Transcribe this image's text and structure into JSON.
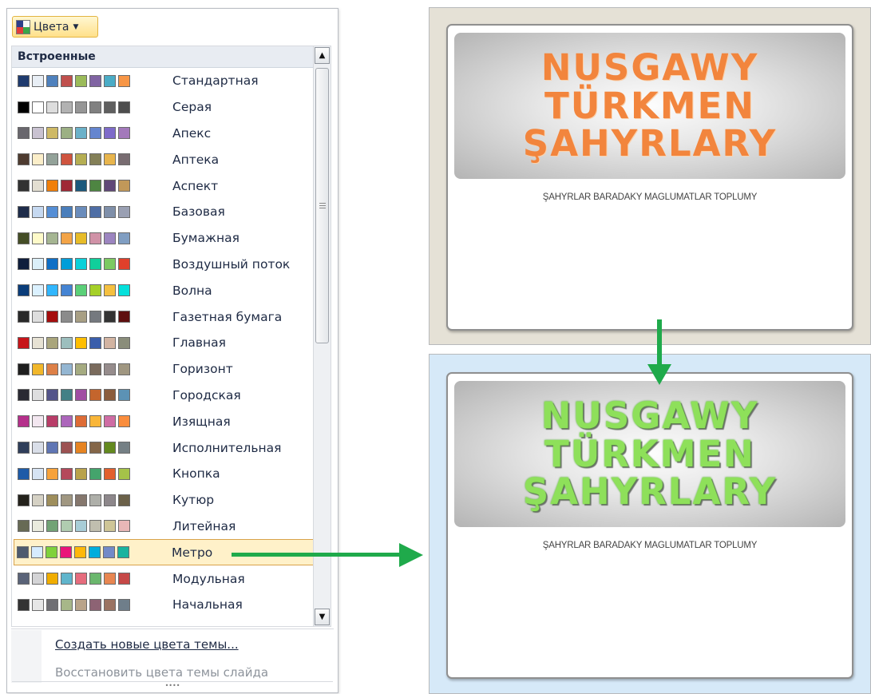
{
  "colors_button": {
    "label": "Цвета",
    "icon": "color-scheme-icon",
    "icon_colors": [
      "#2c3e8a",
      "#f7f7f7",
      "#e23b3b",
      "#3aa64a"
    ]
  },
  "panel": {
    "section_title": "Встроенные",
    "scroll_position": 0.0,
    "schemes": [
      {
        "name": "Стандартная",
        "selected": false,
        "colors": [
          "#1f3b6e",
          "#e8eef5",
          "#4f81bd",
          "#c0504d",
          "#9bbb59",
          "#8064a2",
          "#4bacc6",
          "#f79646"
        ]
      },
      {
        "name": "Серая",
        "selected": false,
        "colors": [
          "#000000",
          "#ffffff",
          "#dddddd",
          "#b2b2b2",
          "#969696",
          "#808080",
          "#5f5f5f",
          "#4d4d4d"
        ]
      },
      {
        "name": "Апекс",
        "selected": false,
        "colors": [
          "#69676d",
          "#c9c2d1",
          "#ceb966",
          "#9cb084",
          "#6bb1c9",
          "#6585cf",
          "#7e6bc9",
          "#a379bb"
        ]
      },
      {
        "name": "Аптека",
        "selected": false,
        "colors": [
          "#4e3b30",
          "#fbeec9",
          "#93a299",
          "#cf543f",
          "#b5ae53",
          "#848058",
          "#e8b54d",
          "#786c71"
        ]
      },
      {
        "name": "Аспект",
        "selected": false,
        "colors": [
          "#323232",
          "#e3ded1",
          "#f07f09",
          "#9f2936",
          "#1b587c",
          "#4e8542",
          "#604878",
          "#c19859"
        ]
      },
      {
        "name": "Базовая",
        "selected": false,
        "colors": [
          "#1e2c4a",
          "#c6d9f1",
          "#558ed5",
          "#4a7ebb",
          "#6a8cbb",
          "#4f6ea5",
          "#7f8fa9",
          "#9aa0b3"
        ]
      },
      {
        "name": "Бумажная",
        "selected": false,
        "colors": [
          "#444d26",
          "#fefac9",
          "#a5b592",
          "#f3a447",
          "#e7bc29",
          "#d092a7",
          "#9c85c0",
          "#809ec2"
        ]
      },
      {
        "name": "Воздушный поток",
        "selected": false,
        "colors": [
          "#0f1e3c",
          "#dbeff9",
          "#0f6fc6",
          "#009dd9",
          "#0bd0d9",
          "#10cf9b",
          "#7cca62",
          "#e0402b"
        ]
      },
      {
        "name": "Волна",
        "selected": false,
        "colors": [
          "#0a3d7a",
          "#dbf1ff",
          "#31b6fd",
          "#4584d3",
          "#5bd078",
          "#a5d028",
          "#f5c040",
          "#05e0db"
        ]
      },
      {
        "name": "Газетная бумага",
        "selected": false,
        "colors": [
          "#292929",
          "#dedede",
          "#a50e0e",
          "#8b8b8b",
          "#a89f84",
          "#75797f",
          "#333333",
          "#5e0f0f"
        ]
      },
      {
        "name": "Главная",
        "selected": false,
        "colors": [
          "#c7151a",
          "#e7e2d4",
          "#a9a57c",
          "#9cbebd",
          "#ffbe00",
          "#3a5eab",
          "#d2b4a2",
          "#8a8d7a"
        ]
      },
      {
        "name": "Горизонт",
        "selected": false,
        "colors": [
          "#1f1f1f",
          "#f1b72b",
          "#dd8047",
          "#94b6d2",
          "#a5ab81",
          "#7a6b5d",
          "#968c8c",
          "#a09781"
        ]
      },
      {
        "name": "Городская",
        "selected": false,
        "colors": [
          "#2a2a33",
          "#dededf",
          "#53548a",
          "#438086",
          "#a04da3",
          "#c4652d",
          "#8b5d3d",
          "#5c92b5"
        ]
      },
      {
        "name": "Изящная",
        "selected": false,
        "colors": [
          "#b5308b",
          "#f3e7f0",
          "#b83d68",
          "#ac66bb",
          "#de6c36",
          "#f9b639",
          "#cf6da4",
          "#fa8d3d"
        ]
      },
      {
        "name": "Исполнительная",
        "selected": false,
        "colors": [
          "#2f3e5a",
          "#d9dee8",
          "#6076b4",
          "#9c5252",
          "#e68422",
          "#846648",
          "#63891f",
          "#758085"
        ]
      },
      {
        "name": "Кнопка",
        "selected": false,
        "colors": [
          "#1e5ba8",
          "#d6e3f3",
          "#f7a23b",
          "#b5495b",
          "#b9a24b",
          "#44a46c",
          "#e25f2d",
          "#a5c249"
        ]
      },
      {
        "name": "Кутюр",
        "selected": false,
        "colors": [
          "#24221c",
          "#d5d1c4",
          "#9e8e5c",
          "#a09781",
          "#85776d",
          "#aeafa9",
          "#8d878b",
          "#6b6149"
        ]
      },
      {
        "name": "Литейная",
        "selected": false,
        "colors": [
          "#676a55",
          "#eaebde",
          "#72a376",
          "#b0ccb0",
          "#a8cdd7",
          "#c0beaf",
          "#cec597",
          "#e8b7b7"
        ]
      },
      {
        "name": "Метро",
        "selected": true,
        "colors": [
          "#4e5b6f",
          "#d6ecff",
          "#7fd13b",
          "#ea157a",
          "#feb80a",
          "#00addc",
          "#738ac8",
          "#1ab39f"
        ]
      },
      {
        "name": "Модульная",
        "selected": false,
        "colors": [
          "#5a6378",
          "#d4d4d6",
          "#f0ad00",
          "#60b5cc",
          "#e66c7d",
          "#6bb76d",
          "#e88651",
          "#c64847"
        ]
      },
      {
        "name": "Начальная",
        "selected": false,
        "colors": [
          "#333333",
          "#e6e6e6",
          "#6f6f74",
          "#a7b789",
          "#b9a489",
          "#8d6374",
          "#9b7362",
          "#6f7e8a"
        ]
      }
    ],
    "create_label": "Создать новые цвета темы...",
    "restore_label": "Восстановить цвета темы слайда"
  },
  "slides": [
    {
      "title_lines": [
        "NUSGAWY",
        "TÜRKMEN",
        "ŞAHYRLARY"
      ],
      "subtitle": "ŞAHYRLAR BARADAKY MAGLUMATLAR TOPLUMY",
      "title_color": "#f2853d",
      "background": "#e5e1d6"
    },
    {
      "title_lines": [
        "NUSGAWY",
        "TÜRKMEN",
        "ŞAHYRLARY"
      ],
      "subtitle": "ŞAHYRLAR BARADAKY MAGLUMATLAR TOPLUMY",
      "title_color": "#8ee05a",
      "background": "#d6e9f8"
    }
  ],
  "arrow_color": "#1faa4b"
}
